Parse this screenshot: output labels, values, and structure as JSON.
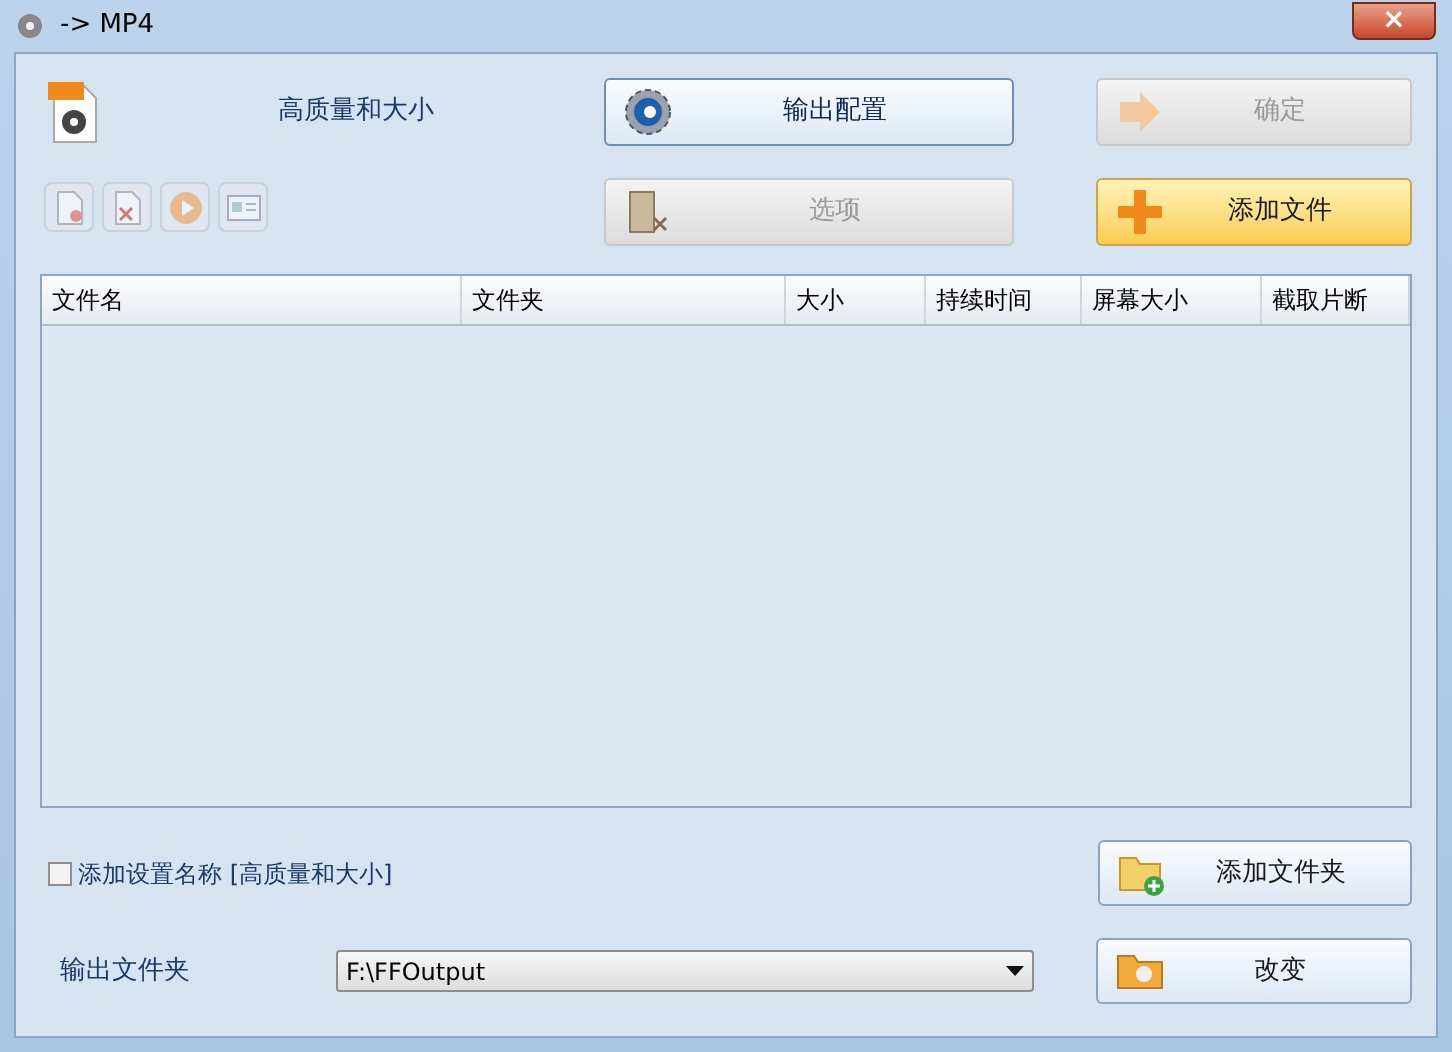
{
  "window": {
    "title": "-> MP4",
    "close": "×"
  },
  "preset": {
    "label": "高质量和大小"
  },
  "buttons": [
    {
      "label": "输出配置",
      "kind": "config",
      "disabled": false
    },
    {
      "label": "确定",
      "kind": "ok",
      "disabled": true
    },
    {
      "label": "选项",
      "kind": "options",
      "disabled": true
    },
    {
      "label": "添加文件",
      "kind": "add",
      "disabled": false
    }
  ],
  "toolbar": [
    {
      "kind": "new",
      "disabled": true
    },
    {
      "kind": "delete",
      "disabled": true
    },
    {
      "kind": "play",
      "disabled": true
    },
    {
      "kind": "info",
      "disabled": true
    }
  ],
  "table": {
    "columns": [
      "文件名",
      "文件夹",
      "大小",
      "持续时间",
      "屏幕大小",
      "截取片断"
    ]
  },
  "checkbox": {
    "label": "添加设置名称 [高质量和大小]",
    "checked": false
  },
  "add_folder_button": {
    "label": "添加文件夹"
  },
  "output": {
    "label": "输出文件夹",
    "value": "F:\\FFOutput"
  },
  "change_button": {
    "label": "改变"
  }
}
